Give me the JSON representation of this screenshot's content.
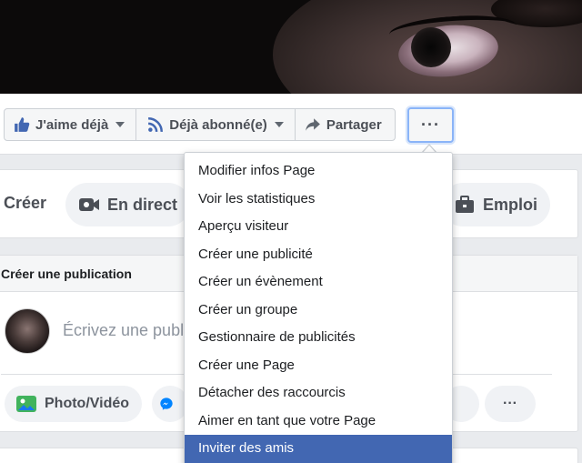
{
  "toolbar": {
    "like_label": "J'aime déjà",
    "follow_label": "Déjà abonné(e)",
    "share_label": "Partager",
    "more_label": "···"
  },
  "create": {
    "title": "Créer",
    "live_label": "En direct",
    "job_label": "Emploi"
  },
  "publication": {
    "header": "Créer une publication",
    "placeholder": "Écrivez une publ",
    "photo_label": "Photo/Vidéo",
    "more_label": "···"
  },
  "menu": {
    "items": [
      "Modifier infos Page",
      "Voir les statistiques",
      "Aperçu visiteur",
      "Créer une publicité",
      "Créer un évènement",
      "Créer un groupe",
      "Gestionnaire de publicités",
      "Créer une Page",
      "Détacher des raccourcis",
      "Aimer en tant que votre Page",
      "Inviter des amis"
    ],
    "active_index": 10
  },
  "colors": {
    "accent": "#4267b2",
    "focus": "#8ab4f8",
    "text_secondary": "#4b4f56"
  }
}
